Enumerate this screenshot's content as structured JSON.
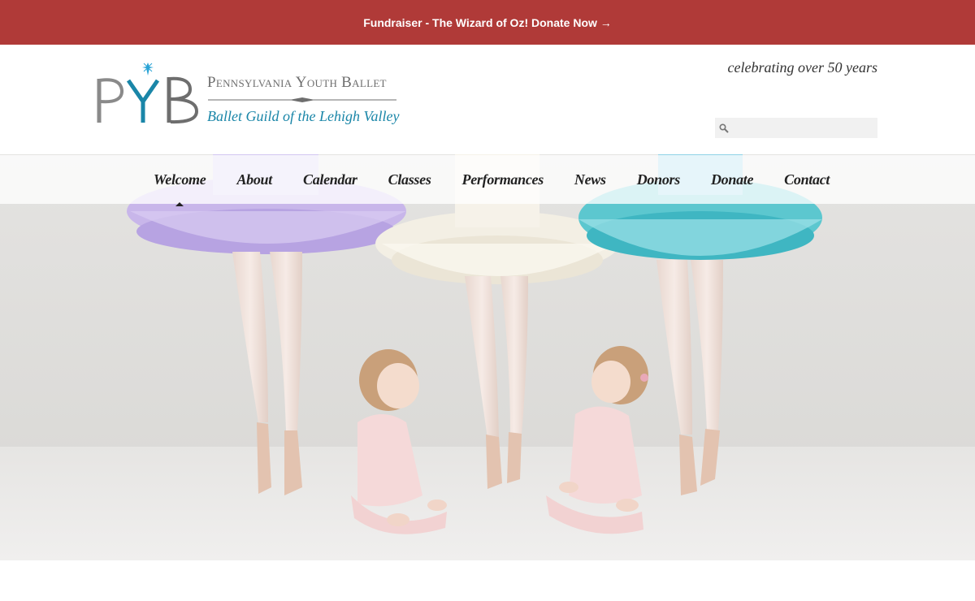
{
  "announcement": {
    "text": "Fundraiser - The Wizard of Oz! Donate Now →",
    "bg_color": "#b03a38"
  },
  "header": {
    "logo_mark_text": "PYB",
    "logo_title": "Pennsylvania Youth Ballet",
    "logo_subtitle": "Ballet Guild of the Lehigh Valley",
    "tagline": "celebrating over 50 years",
    "search": {
      "placeholder": "",
      "value": "",
      "icon": "search-icon"
    }
  },
  "nav": {
    "items": [
      {
        "label": "Welcome",
        "active": true
      },
      {
        "label": "About"
      },
      {
        "label": "Calendar"
      },
      {
        "label": "Classes"
      },
      {
        "label": "Performances"
      },
      {
        "label": "News"
      },
      {
        "label": "Donors"
      },
      {
        "label": "Donate"
      },
      {
        "label": "Contact"
      }
    ]
  },
  "colors": {
    "brand_teal": "#1a86a8",
    "brand_gray": "#6e6e6e",
    "star_blue": "#2aa4d6"
  }
}
